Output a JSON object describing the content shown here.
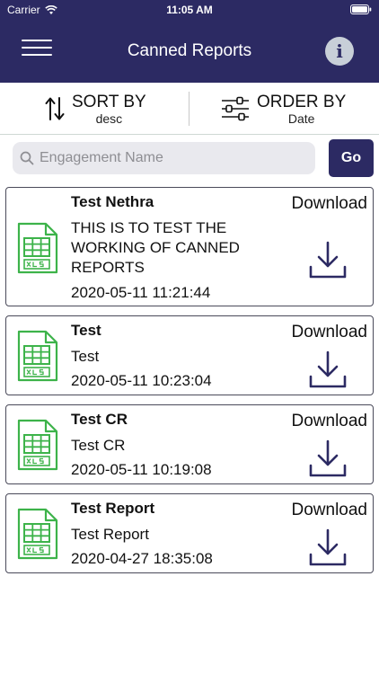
{
  "status_bar": {
    "carrier": "Carrier",
    "time": "11:05 AM"
  },
  "nav": {
    "title": "Canned Reports",
    "menu_icon": "hamburger-icon",
    "info_icon": "info-icon",
    "info_glyph": "i"
  },
  "sort": {
    "sort_by_label": "SORT BY",
    "sort_by_value": "desc",
    "order_by_label": "ORDER BY",
    "order_by_value": "Date"
  },
  "search": {
    "placeholder": "Engagement Name",
    "value": "",
    "go_label": "Go"
  },
  "colors": {
    "nav_bg": "#2c2a63",
    "xls_green": "#3db34a",
    "download_icon": "#2c2a63"
  },
  "reports": [
    {
      "name": "Test Nethra",
      "description": "THIS IS TO TEST THE WORKING OF CANNED REPORTS",
      "date": "2020-05-11 11:21:44",
      "download_label": "Download"
    },
    {
      "name": "Test",
      "description": "Test",
      "date": "2020-05-11 10:23:04",
      "download_label": "Download"
    },
    {
      "name": "Test CR",
      "description": "Test CR",
      "date": "2020-05-11 10:19:08",
      "download_label": "Download"
    },
    {
      "name": "Test Report",
      "description": "Test Report",
      "date": "2020-04-27 18:35:08",
      "download_label": "Download"
    }
  ]
}
